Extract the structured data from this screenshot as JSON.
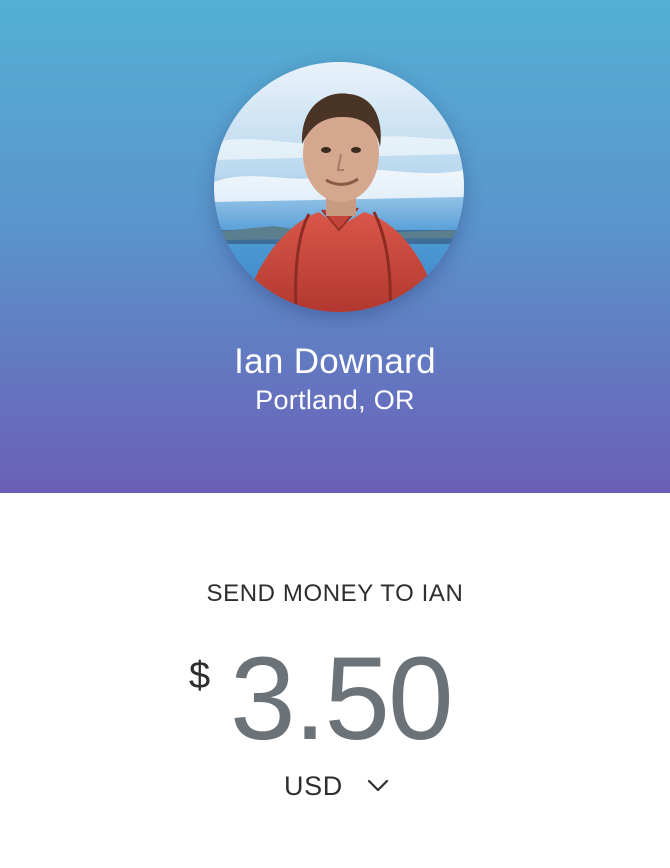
{
  "recipient": {
    "name": "Ian Downard",
    "location": "Portland, OR",
    "avatar_icon": "profile-photo"
  },
  "send": {
    "heading": "SEND MONEY TO IAN",
    "currency_symbol": "$",
    "amount": "3.50",
    "currency_code": "USD",
    "currency_chevron_icon": "chevron-down-icon"
  },
  "colors": {
    "gradient_top": "#54b0d4",
    "gradient_bottom": "#6b5fb8",
    "amount_text": "#6c7378",
    "dark_text": "#2c2e2f"
  }
}
